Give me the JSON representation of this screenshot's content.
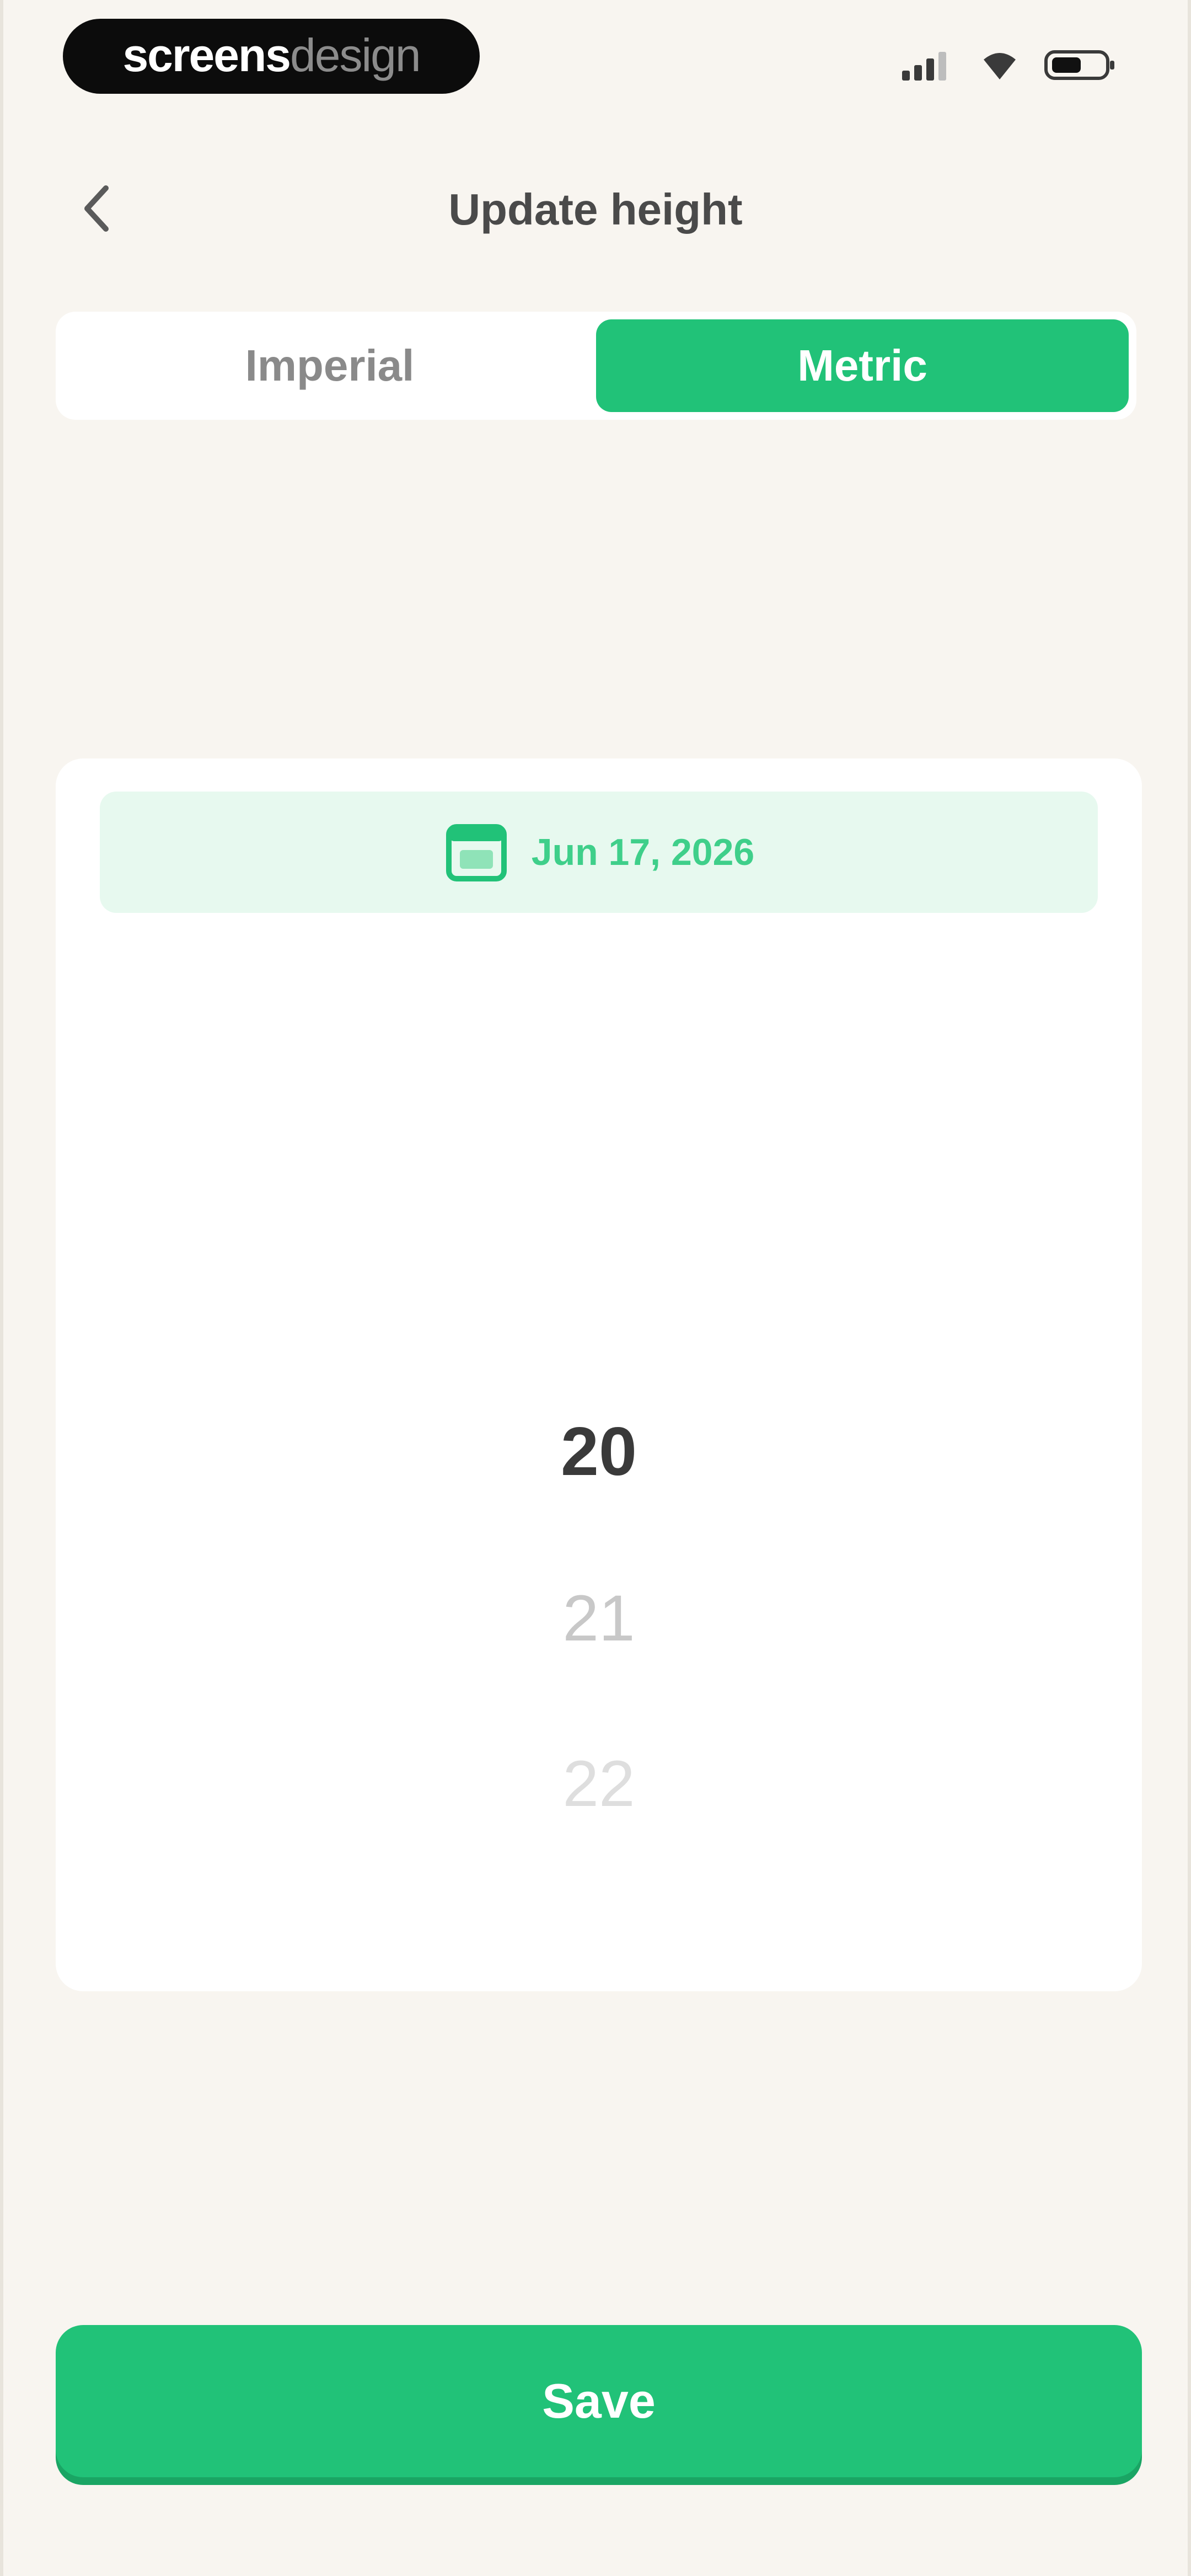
{
  "status_bar": {
    "brand_part1": "screens",
    "brand_part2": "design",
    "icons": [
      "signal-icon",
      "wifi-icon",
      "battery-icon"
    ]
  },
  "header": {
    "back_icon": "chevron-left-icon",
    "title": "Update height"
  },
  "unit_toggle": {
    "options": [
      {
        "label": "Imperial",
        "selected": false
      },
      {
        "label": "Metric",
        "selected": true
      }
    ]
  },
  "picker": {
    "date_icon": "calendar-icon",
    "date": "Jun 17, 2026",
    "values": [
      "20",
      "21",
      "22"
    ],
    "selected_value": "20"
  },
  "actions": {
    "save_label": "Save"
  },
  "colors": {
    "accent": "#21c278",
    "background": "#f8f5f0",
    "date_chip_bg": "#e7f9ef"
  }
}
